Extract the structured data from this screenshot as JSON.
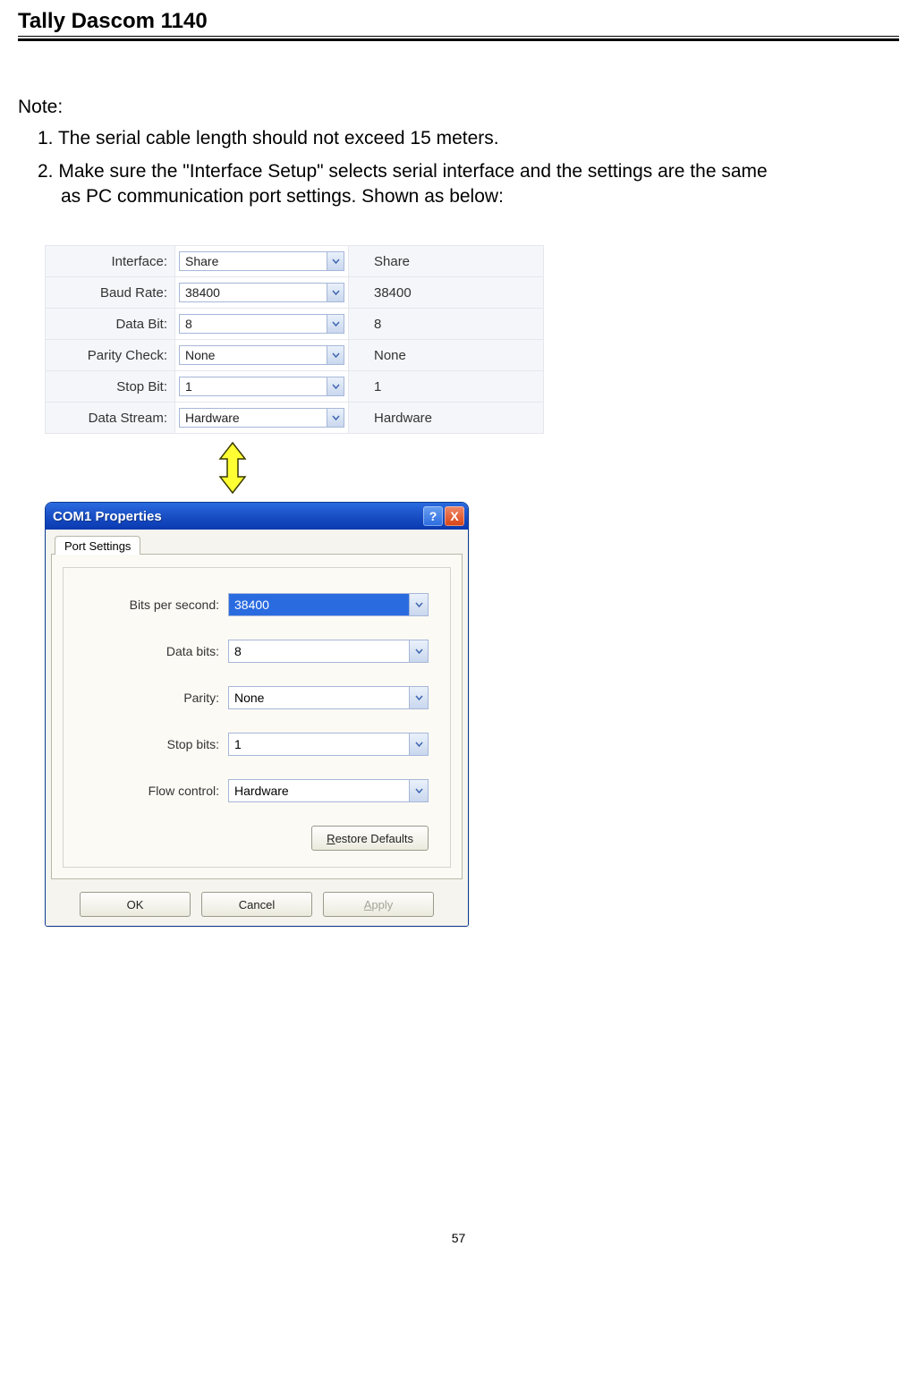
{
  "header": {
    "title": "Tally Dascom 1140"
  },
  "note_heading": "Note:",
  "notes": [
    "1. The serial cable length should not exceed 15 meters.",
    "2. Make sure the \"Interface Setup\" selects serial interface and the settings are the same",
    "as PC communication port settings. Shown as below:"
  ],
  "setup": {
    "rows": [
      {
        "label": "Interface:",
        "value": "Share",
        "display": "Share"
      },
      {
        "label": "Baud Rate:",
        "value": "38400",
        "display": "38400"
      },
      {
        "label": "Data Bit:",
        "value": "8",
        "display": "8"
      },
      {
        "label": "Parity Check:",
        "value": "None",
        "display": "None"
      },
      {
        "label": "Stop Bit:",
        "value": "1",
        "display": "1"
      },
      {
        "label": "Data Stream:",
        "value": "Hardware",
        "display": "Hardware"
      }
    ]
  },
  "xp": {
    "title": "COM1 Properties",
    "help": "?",
    "close": "X",
    "tab": "Port Settings",
    "fields": [
      {
        "label": "Bits per second:",
        "value": "38400",
        "selected": true
      },
      {
        "label": "Data bits:",
        "value": "8"
      },
      {
        "label": "Parity:",
        "value": "None"
      },
      {
        "label": "Stop bits:",
        "value": "1"
      },
      {
        "label": "Flow control:",
        "value": "Hardware"
      }
    ],
    "restore": "Restore Defaults",
    "ok": "OK",
    "cancel": "Cancel",
    "apply": "Apply"
  },
  "page_number": "57"
}
